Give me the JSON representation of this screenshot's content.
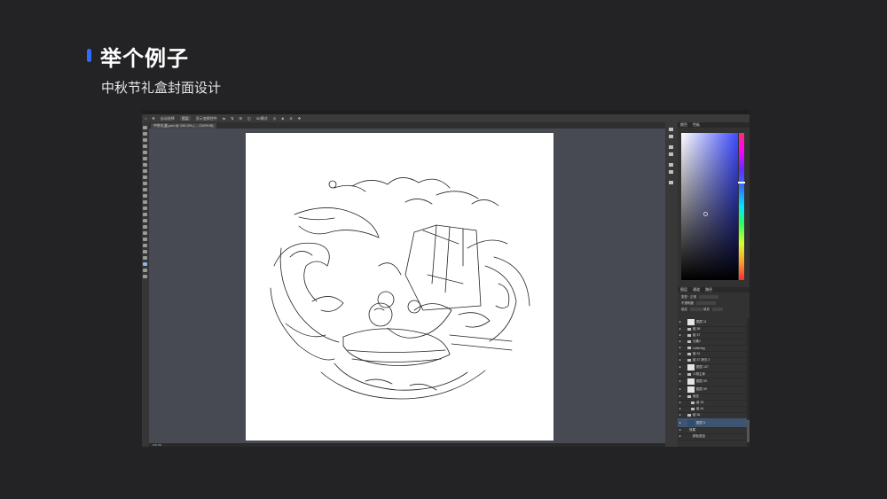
{
  "slide": {
    "title": "举个例子",
    "subtitle": "中秋节礼盒封面设计",
    "accent_color": "#2f6bff"
  },
  "photoshop": {
    "options_bar": [
      "⌂",
      "✥",
      "自动选择",
      "图层",
      "显示变换控件",
      "⇆",
      "⇅",
      "⊞",
      "◫",
      "3D模式",
      "◎",
      "◈",
      "⊛",
      "✥"
    ],
    "document_tab": "中秋礼盒.psd @ 100.3% (..., CMYK/8)",
    "status_text": "100.3%",
    "panels": {
      "color_tabs": [
        "颜色",
        "色板"
      ],
      "layer_tabs": [
        "图层",
        "通道",
        "路径"
      ],
      "blend_row": "类型 · 正常",
      "opacity_label": "不透明度",
      "fill_label": "填充",
      "lock_label": "锁定"
    },
    "layers": [
      {
        "name": "图层 11",
        "type": "layer"
      },
      {
        "name": "组 38",
        "type": "folder"
      },
      {
        "name": "组 37",
        "type": "folder"
      },
      {
        "name": "元素1",
        "type": "folder"
      },
      {
        "name": "Lettering",
        "type": "folder"
      },
      {
        "name": "组 31",
        "type": "folder"
      },
      {
        "name": "组 37 拷贝 2",
        "type": "folder"
      },
      {
        "name": "图层 107",
        "type": "layer"
      },
      {
        "name": "人物主体",
        "type": "folder"
      },
      {
        "name": "图层 93",
        "type": "layer"
      },
      {
        "name": "图层 99",
        "type": "layer"
      },
      {
        "name": "浪花",
        "type": "folder"
      },
      {
        "name": "组 33",
        "type": "folder"
      },
      {
        "name": "组 44",
        "type": "folder"
      },
      {
        "name": "组 36",
        "type": "folder"
      },
      {
        "name": "图层 5",
        "type": "layer-blue"
      },
      {
        "name": "效果",
        "type": "effect"
      },
      {
        "name": "颜色叠加",
        "type": "effect"
      }
    ]
  }
}
